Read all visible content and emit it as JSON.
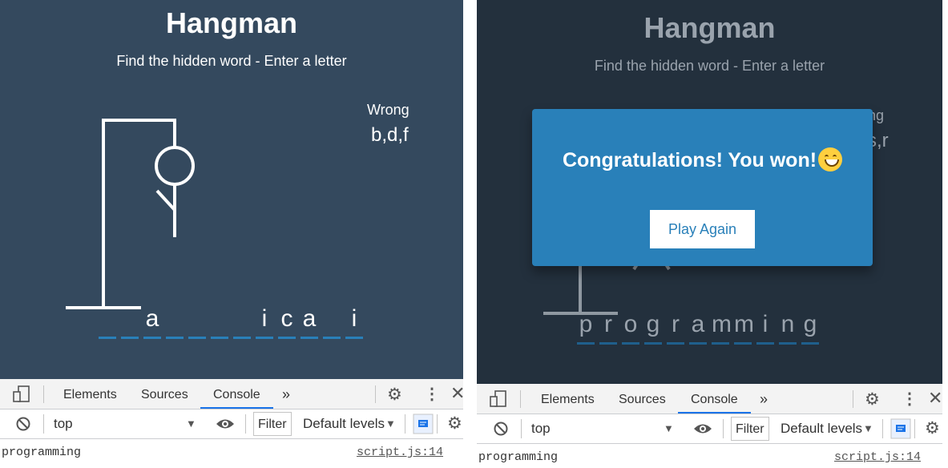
{
  "game": {
    "title": "Hangman",
    "subtitle": "Find the hidden word - Enter a letter",
    "wrong_label": "Wrong"
  },
  "left": {
    "wrong_letters": "b,d,f",
    "word": [
      "",
      "",
      "a",
      "",
      "",
      "",
      "",
      "i",
      "c",
      "a",
      "",
      "i"
    ]
  },
  "right": {
    "wrong_label_partial": "ng",
    "wrong_letters_partial": "s,r",
    "word": [
      "p",
      "r",
      "o",
      "g",
      "r",
      "a",
      "m",
      "m",
      "i",
      "n",
      "g"
    ],
    "popup": {
      "message": "Congratulations! You won!",
      "emoji": "grinning-face",
      "button": "Play Again"
    }
  },
  "devtools": {
    "tabs": [
      "Elements",
      "Sources",
      "Console"
    ],
    "active_tab": "Console",
    "more": "»",
    "context": "top",
    "filter": "Filter",
    "levels": "Default levels",
    "log_text": "programming",
    "log_source": "script.js:14"
  },
  "colors": {
    "bg": "#34495e",
    "accent": "#2980b9",
    "devtools_active": "#1a73e8"
  }
}
